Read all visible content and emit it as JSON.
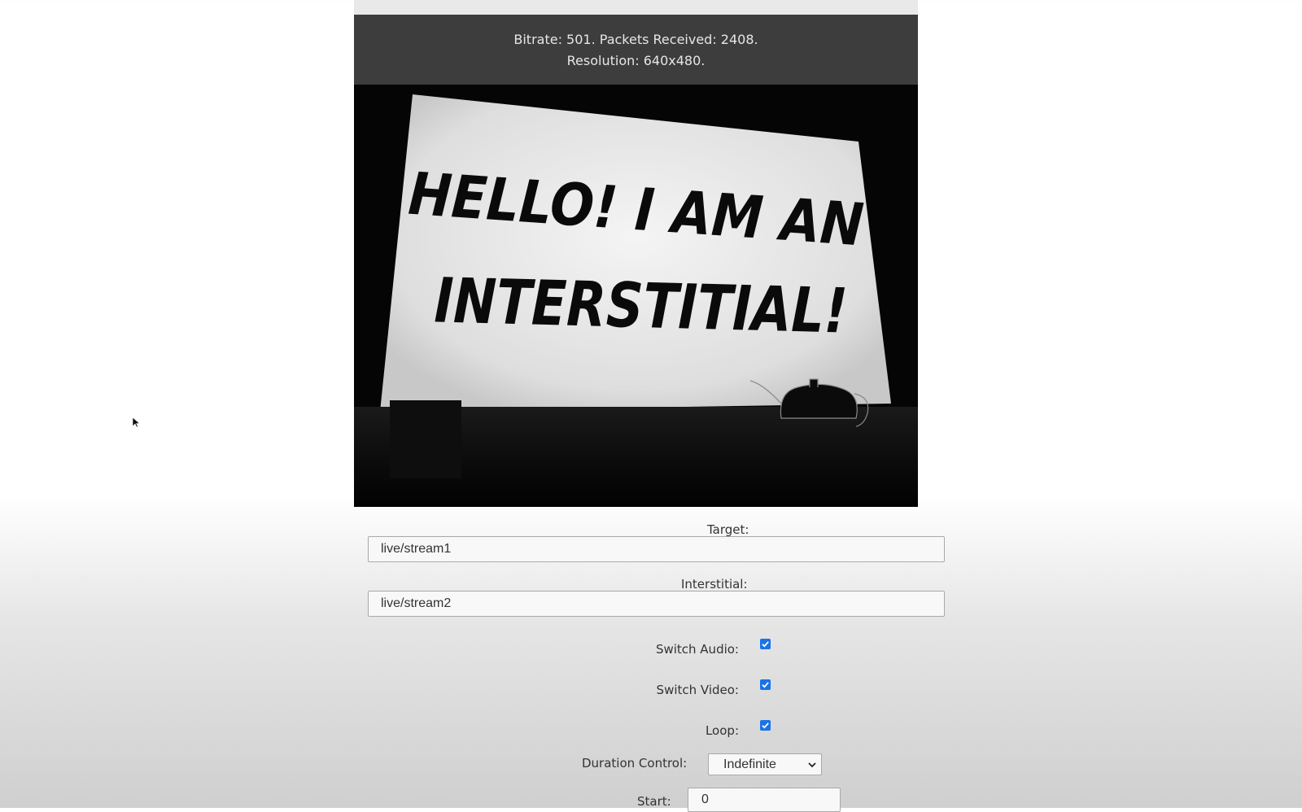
{
  "stats": {
    "line1": "Bitrate: 501.  Packets Received: 2408.",
    "line2": "Resolution: 640x480."
  },
  "video": {
    "line1": "HELLO! I AM AN",
    "line2": "INTERSTITIAL!"
  },
  "form": {
    "target_label": "Target:",
    "target_value": "live/stream1",
    "interstitial_label": "Interstitial:",
    "interstitial_value": "live/stream2",
    "switch_audio_label": "Switch Audio:",
    "switch_audio_checked": true,
    "switch_video_label": "Switch Video:",
    "switch_video_checked": true,
    "loop_label": "Loop:",
    "loop_checked": true,
    "duration_label": "Duration Control:",
    "duration_value": "Indefinite",
    "start_label": "Start:",
    "start_value": "0"
  },
  "icons": {
    "checkbox_icon": "checkmark",
    "dropdown_icon": "chevron-down-icon",
    "cursor_icon": "arrow-cursor"
  },
  "colors": {
    "checkbox_accent": "#1a73e8",
    "stats_bar": "#3d3d3d"
  }
}
